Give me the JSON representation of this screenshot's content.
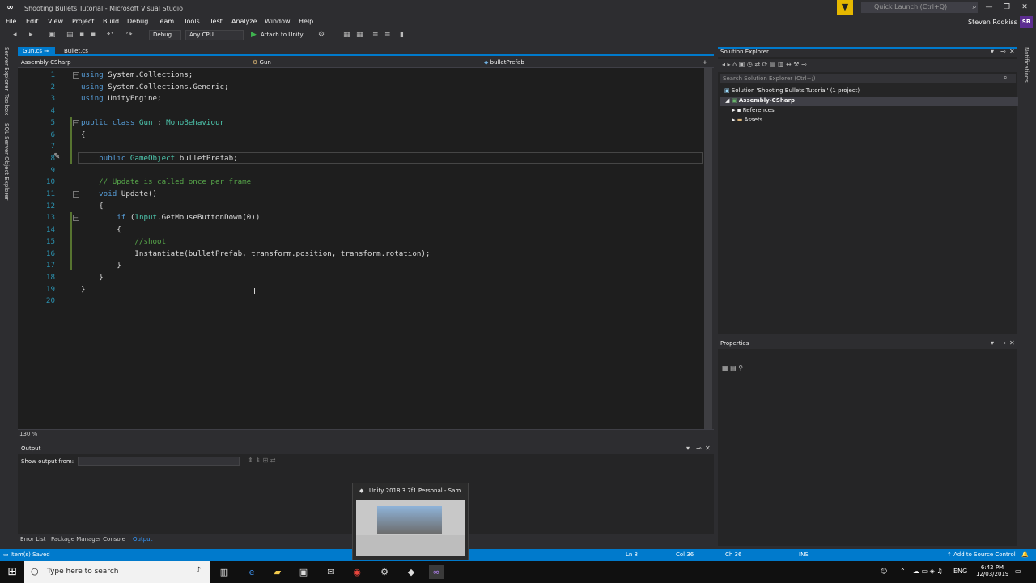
{
  "window": {
    "title": "Shooting Bullets Tutorial - Microsoft Visual Studio",
    "quick_launch_placeholder": "Quick Launch (Ctrl+Q)",
    "user": "Steven Rodkiss",
    "avatar": "SR"
  },
  "menu": [
    "File",
    "Edit",
    "View",
    "Project",
    "Build",
    "Debug",
    "Team",
    "Tools",
    "Test",
    "Analyze",
    "Window",
    "Help"
  ],
  "toolbar": {
    "config": "Debug",
    "platform": "Any CPU",
    "attach": "Attach to Unity"
  },
  "left_rail": [
    "Server Explorer",
    "Toolbox",
    "SQL Server Object Explorer"
  ],
  "tabs": [
    {
      "label": "Gun.cs",
      "active": true
    },
    {
      "label": "Bullet.cs",
      "active": false
    }
  ],
  "navbar": {
    "project": "Assembly-CSharp",
    "class": "Gun",
    "member": "bulletPrefab"
  },
  "code": [
    {
      "n": "1",
      "t": [
        [
          "kw",
          "using"
        ],
        [
          "tx",
          " System.Collections;"
        ]
      ]
    },
    {
      "n": "2",
      "t": [
        [
          "kw",
          "using"
        ],
        [
          "tx",
          " System.Collections.Generic;"
        ]
      ]
    },
    {
      "n": "3",
      "t": [
        [
          "kw",
          "using"
        ],
        [
          "tx",
          " UnityEngine;"
        ]
      ]
    },
    {
      "n": "4",
      "t": []
    },
    {
      "n": "5",
      "t": [
        [
          "kw",
          "public class "
        ],
        [
          "ty",
          "Gun"
        ],
        [
          "tx",
          " : "
        ],
        [
          "ty",
          "MonoBehaviour"
        ]
      ]
    },
    {
      "n": "6",
      "t": [
        [
          "tx",
          "{"
        ]
      ]
    },
    {
      "n": "7",
      "t": []
    },
    {
      "n": "8",
      "t": [
        [
          "tx",
          "    "
        ],
        [
          "kw",
          "public "
        ],
        [
          "ty",
          "GameObject"
        ],
        [
          "tx",
          " bulletPrefab;"
        ]
      ]
    },
    {
      "n": "9",
      "t": []
    },
    {
      "n": "10",
      "t": [
        [
          "tx",
          "    "
        ],
        [
          "cm",
          "// Update is called once per frame"
        ]
      ]
    },
    {
      "n": "11",
      "t": [
        [
          "tx",
          "    "
        ],
        [
          "kw",
          "void"
        ],
        [
          "tx",
          " Update()"
        ]
      ]
    },
    {
      "n": "12",
      "t": [
        [
          "tx",
          "    {"
        ]
      ]
    },
    {
      "n": "13",
      "t": [
        [
          "tx",
          "        "
        ],
        [
          "kw",
          "if"
        ],
        [
          "tx",
          " ("
        ],
        [
          "ty",
          "Input"
        ],
        [
          "tx",
          ".GetMouseButtonDown(0))"
        ]
      ]
    },
    {
      "n": "14",
      "t": [
        [
          "tx",
          "        {"
        ]
      ]
    },
    {
      "n": "15",
      "t": [
        [
          "tx",
          "            "
        ],
        [
          "cm",
          "//shoot"
        ]
      ]
    },
    {
      "n": "16",
      "t": [
        [
          "tx",
          "            Instantiate(bulletPrefab, transform.position, transform.rotation);"
        ]
      ]
    },
    {
      "n": "17",
      "t": [
        [
          "tx",
          "        }"
        ]
      ]
    },
    {
      "n": "18",
      "t": [
        [
          "tx",
          "    }"
        ]
      ]
    },
    {
      "n": "19",
      "t": [
        [
          "tx",
          "}"
        ]
      ]
    },
    {
      "n": "20",
      "t": []
    }
  ],
  "zoom": "130 %",
  "output": {
    "title": "Output",
    "show_from": "Show output from:"
  },
  "bottom_tabs": [
    "Error List",
    "Package Manager Console",
    "Output"
  ],
  "solution_explorer": {
    "title": "Solution Explorer",
    "search_placeholder": "Search Solution Explorer (Ctrl+;)",
    "solution": "Solution 'Shooting Bullets Tutorial' (1 project)",
    "project": "Assembly-CSharp",
    "references": "References",
    "assets": "Assets"
  },
  "properties": {
    "title": "Properties"
  },
  "right_rail": "Notifications",
  "statusbar": {
    "message": "Item(s) Saved",
    "ln": "Ln 8",
    "col": "Col 36",
    "ch": "Ch 36",
    "ins": "INS",
    "source": "Add to Source Control"
  },
  "taskbar": {
    "search_placeholder": "Type here to search",
    "lang": "ENG",
    "time": "6:42 PM",
    "date": "12/03/2019"
  },
  "thumbnail": {
    "title": "Unity 2018.3.7f1 Personal - Sam..."
  },
  "colors": {
    "accent": "#007acc",
    "bg": "#2d2d30",
    "editor": "#1e1e1e",
    "keyword": "#569cd6",
    "type": "#4ec9b0",
    "comment": "#57a64a"
  }
}
